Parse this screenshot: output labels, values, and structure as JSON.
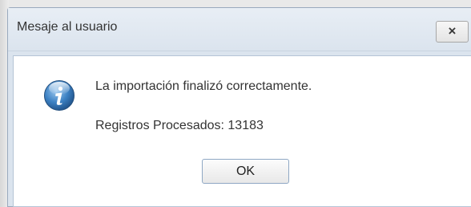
{
  "dialog": {
    "title": "Mesaje al usuario",
    "close_label": "×",
    "icon": "info-icon",
    "message": "La importación finalizó correctamente.",
    "detail": "Registros Procesados: 13183",
    "ok_label": "OK"
  },
  "colors": {
    "titlebar_bg": "#dbe4ee",
    "border": "#99a9bd",
    "icon_blue": "#2f6fb0"
  }
}
